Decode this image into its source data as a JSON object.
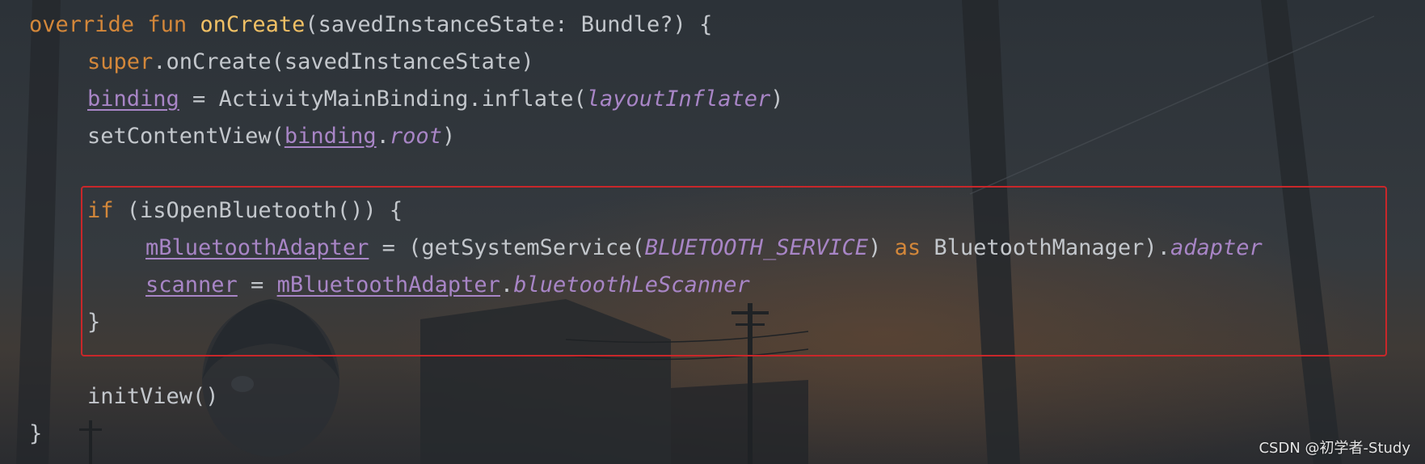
{
  "code": {
    "l1": {
      "kw1": "override",
      "kw2": "fun",
      "fn": "onCreate",
      "rest": "(savedInstanceState: Bundle?) {"
    },
    "l2": {
      "kw": "super",
      "rest": ".onCreate(savedInstanceState)"
    },
    "l3": {
      "prop": "binding",
      "mid": " = ActivityMainBinding.inflate(",
      "ital": "layoutInflater",
      "end": ")"
    },
    "l4": {
      "pre": "setContentView(",
      "prop": "binding",
      "dot": ".",
      "ital": "root",
      "end": ")"
    },
    "l6": {
      "kw": "if",
      "rest": " (isOpenBluetooth()) {"
    },
    "l7": {
      "prop": "mBluetoothAdapter",
      "mid": " = (getSystemService(",
      "cst": "BLUETOOTH_SERVICE",
      "close": ") ",
      "kw": "as",
      "mid2": " BluetoothManager).",
      "ital": "adapter"
    },
    "l8": {
      "prop1": "scanner",
      "mid": " = ",
      "prop2": "mBluetoothAdapter",
      "dot": ".",
      "ital": "bluetoothLeScanner"
    },
    "l9": {
      "brace": "}"
    },
    "l11": {
      "text": "initView()"
    },
    "l12": {
      "brace": "}"
    }
  },
  "watermark": "CSDN @初学者-Study",
  "colors": {
    "background": "#2e3338",
    "keyword": "#d3873a",
    "function": "#f0c065",
    "property": "#a885c6",
    "text": "#c3c7cc",
    "highlight_border": "#c9272a"
  }
}
